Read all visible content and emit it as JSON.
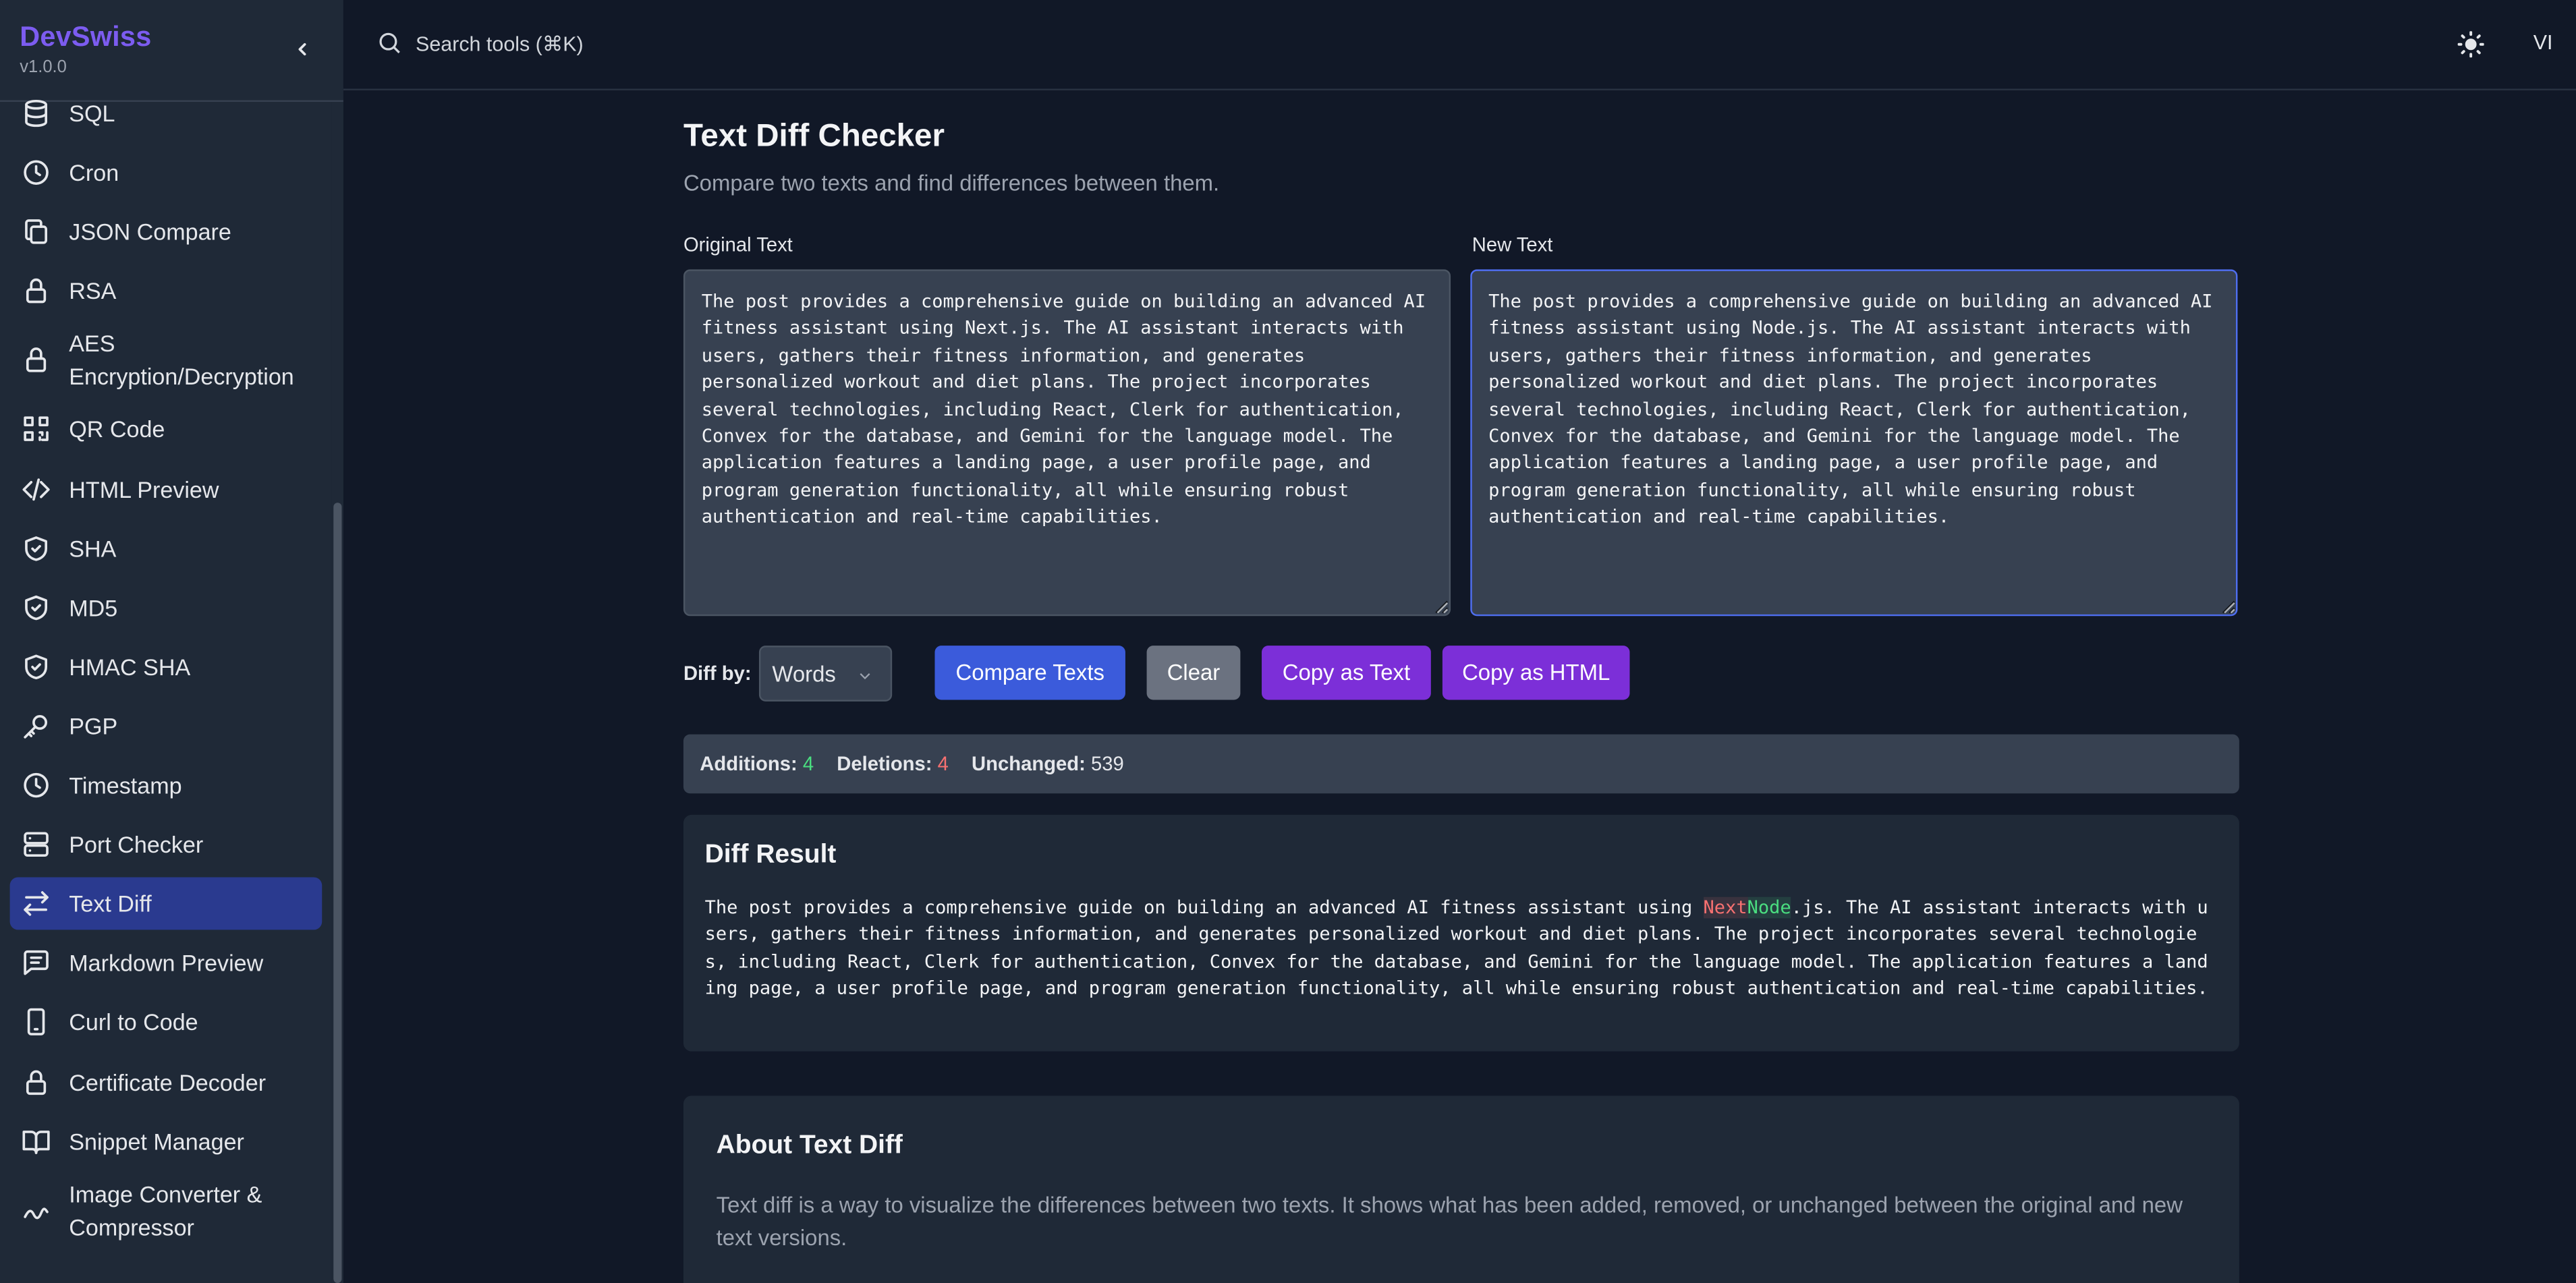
{
  "app": {
    "name": "DevSwiss",
    "version": "v1.0.0"
  },
  "topbar": {
    "search_placeholder": "Search tools (⌘K)",
    "user_initials": "VI"
  },
  "sidebar": {
    "items": [
      {
        "label": "SQL",
        "icon": "database-icon"
      },
      {
        "label": "Cron",
        "icon": "clock-icon"
      },
      {
        "label": "JSON Compare",
        "icon": "copy-icon"
      },
      {
        "label": "RSA",
        "icon": "lock-icon"
      },
      {
        "label": "AES Encryption/Decryption",
        "icon": "lock-icon"
      },
      {
        "label": "QR Code",
        "icon": "qr-code-icon"
      },
      {
        "label": "HTML Preview",
        "icon": "code-icon"
      },
      {
        "label": "SHA",
        "icon": "shield-check-icon"
      },
      {
        "label": "MD5",
        "icon": "shield-check-icon"
      },
      {
        "label": "HMAC SHA",
        "icon": "shield-check-icon"
      },
      {
        "label": "PGP",
        "icon": "key-icon"
      },
      {
        "label": "Timestamp",
        "icon": "clock-icon"
      },
      {
        "label": "Port Checker",
        "icon": "server-icon"
      },
      {
        "label": "Text Diff",
        "icon": "arrows-exchange-icon",
        "active": true
      },
      {
        "label": "Markdown Preview",
        "icon": "message-square-icon"
      },
      {
        "label": "Curl to Code",
        "icon": "phone-icon"
      },
      {
        "label": "Certificate Decoder",
        "icon": "lock-icon"
      },
      {
        "label": "Snippet Manager",
        "icon": "book-open-icon"
      },
      {
        "label": "Image Converter & Compressor",
        "icon": "wave-icon"
      }
    ]
  },
  "page": {
    "title": "Text Diff Checker",
    "subtitle": "Compare two texts and find differences between them."
  },
  "original": {
    "label": "Original Text",
    "value": "The post provides a comprehensive guide on building an advanced AI fitness assistant using Next.js. The AI assistant interacts with users, gathers their fitness information, and generates personalized workout and diet plans. The project incorporates several technologies, including React, Clerk for authentication, Convex for the database, and Gemini for the language model. The application features a landing page, a user profile page, and program generation functionality, all while ensuring robust authentication and real-time capabilities."
  },
  "new_text": {
    "label": "New Text",
    "value": "The post provides a comprehensive guide on building an advanced AI fitness assistant using Node.js. The AI assistant interacts with users, gathers their fitness information, and generates personalized workout and diet plans. The project incorporates several technologies, including React, Clerk for authentication, Convex for the database, and Gemini for the language model. The application features a landing page, a user profile page, and program generation functionality, all while ensuring robust authentication and real-time capabilities."
  },
  "controls": {
    "diff_by_label": "Diff by:",
    "diff_by_value": "Words",
    "compare_label": "Compare Texts",
    "clear_label": "Clear",
    "copy_text_label": "Copy as Text",
    "copy_html_label": "Copy as HTML"
  },
  "stats": {
    "additions_label": "Additions:",
    "additions": "4",
    "deletions_label": "Deletions:",
    "deletions": "4",
    "unchanged_label": "Unchanged:",
    "unchanged": "539"
  },
  "result": {
    "title": "Diff Result",
    "before": "The post provides a comprehensive guide on building an advanced AI fitness assistant using ",
    "removed": "Next",
    "added": "Node",
    "after": ".js. The AI assistant interacts with users, gathers their fitness information, and generates personalized workout and diet plans. The project incorporates several technologies, including React, Clerk for authentication, Convex for the database, and Gemini for the language model. The application features a landing page, a user profile page, and program generation functionality, all while ensuring robust authentication and real-time capabilities."
  },
  "about": {
    "title": "About Text Diff",
    "text": "Text diff is a way to visualize the differences between two texts. It shows what has been added, removed, or unchanged between the original and new text versions."
  },
  "colors": {
    "brand": "#7c5cf0",
    "active_nav": "#2a3a8f",
    "primary_button": "#3b5bdb",
    "copy_button": "#7c2fd8",
    "additions": "#4ade80",
    "deletions": "#f87171"
  }
}
